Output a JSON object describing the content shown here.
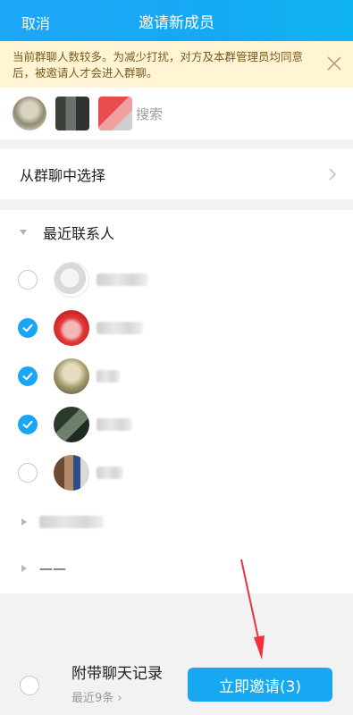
{
  "header": {
    "cancel_label": "取消",
    "title": "邀请新成员"
  },
  "notice": {
    "text": "当前群聊人数较多。为减少打扰，对方及本群管理员均同意后，被邀请人才会进入群聊。"
  },
  "search": {
    "hint": "搜索"
  },
  "group_entry": {
    "label": "从群聊中选择"
  },
  "recent": {
    "label": "最近联系人"
  },
  "contacts": [
    {
      "checked": false
    },
    {
      "checked": true
    },
    {
      "checked": true
    },
    {
      "checked": true
    },
    {
      "checked": false
    }
  ],
  "groups": [
    {
      "label": ""
    },
    {
      "label": "——"
    }
  ],
  "footer": {
    "history_label": "附带聊天记录",
    "history_sub": "最近9条 ›",
    "invite_label": "立即邀请(3)"
  },
  "colors": {
    "accent": "#18a8f2",
    "notice_bg": "#fff5d4",
    "arrow": "#f0303a"
  }
}
